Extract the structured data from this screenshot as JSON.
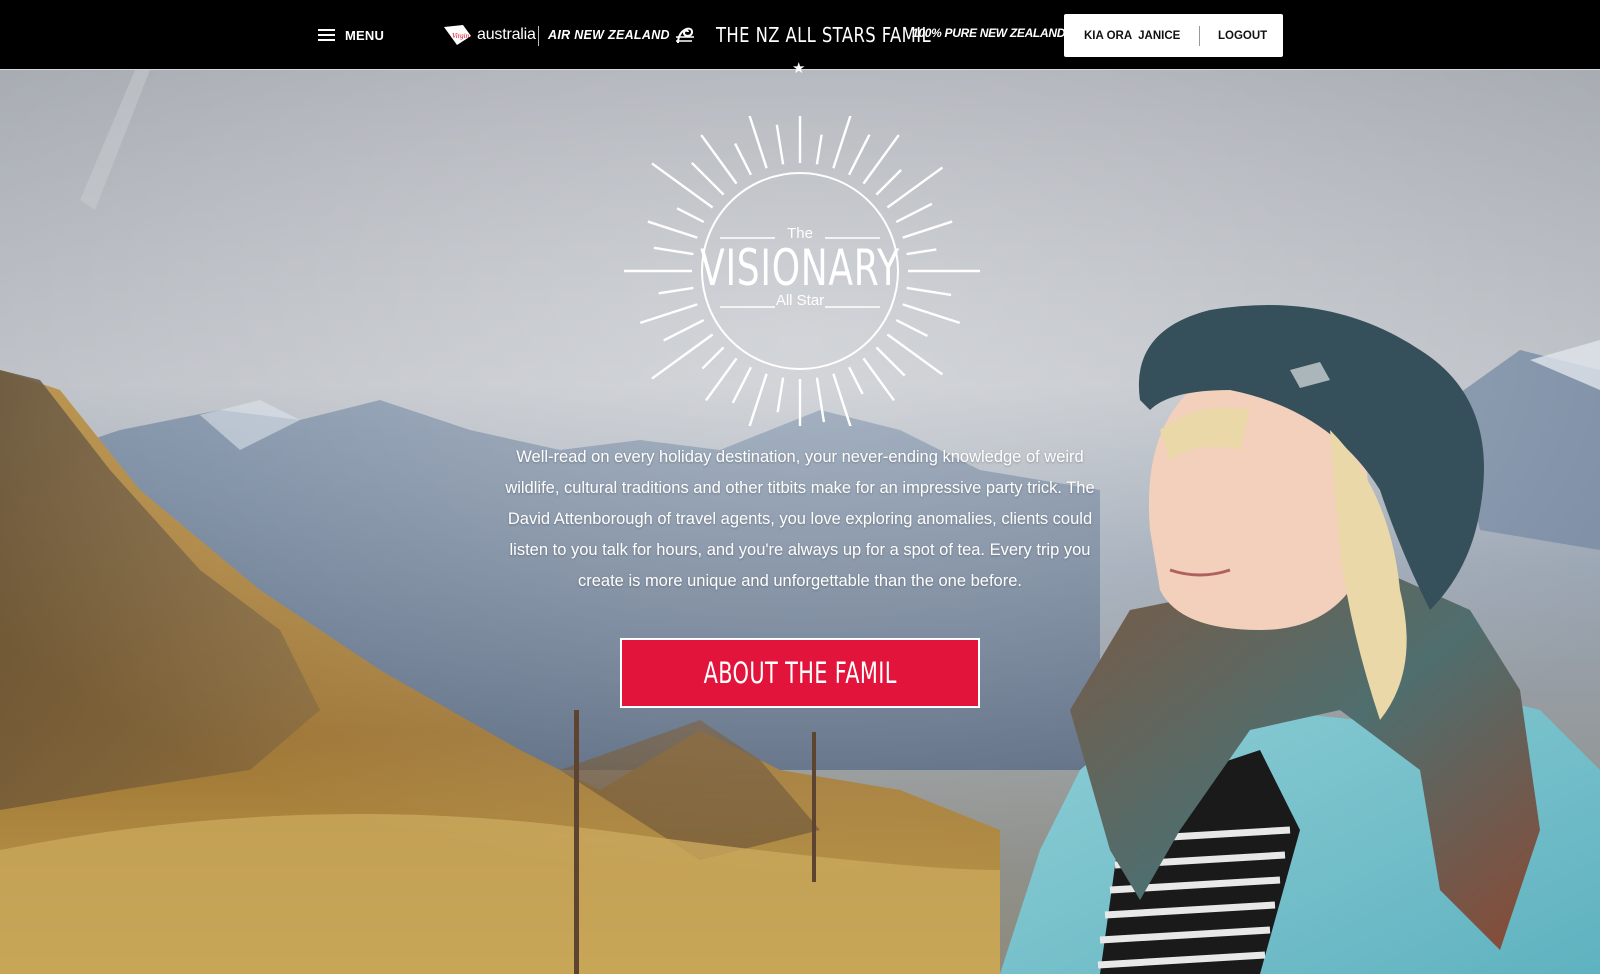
{
  "header": {
    "menu_label": "MENU",
    "brand_virgin": "australia",
    "brand_anz": "AIR NEW ZEALAND",
    "site_title": "THE NZ ALL STARS FAMIL",
    "pure_nz": "100% PURE NEW ZEALAND",
    "greeting": "KIA ORA",
    "user_name": "JANICE",
    "logout_label": "LOGOUT"
  },
  "hero": {
    "badge_the": "The",
    "badge_title": "VISIONARY",
    "badge_subtitle": "All Star",
    "description": "Well-read on every holiday destination, your never-ending knowledge of weird wildlife, cultural traditions and other titbits make for an impressive party trick. The David Attenborough of travel agents, you love exploring anomalies, clients could listen to you talk for hours, and you're always up for a spot of tea. Every trip you create is more unique and unforgettable than the one before.",
    "cta_label": "ABOUT THE FAMIL"
  },
  "colors": {
    "header_bg": "#000000",
    "cta_red": "#e3143b",
    "virgin_red": "#e1001b"
  },
  "icons": {
    "menu": "hamburger-icon",
    "virgin_logo": "virgin-logo",
    "anz_logo": "koru-icon",
    "title_marker": "star-icon",
    "badge": "sunburst-icon"
  }
}
